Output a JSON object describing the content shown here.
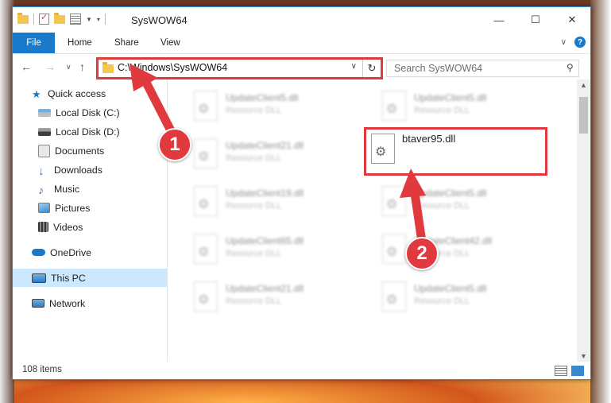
{
  "window": {
    "title": "SysWOW64"
  },
  "ribbon": {
    "tabs": [
      "File",
      "Home",
      "Share",
      "View"
    ]
  },
  "address": {
    "path": "C:\\Windows\\SysWOW64"
  },
  "search": {
    "placeholder": "Search SysWOW64"
  },
  "nav": {
    "items": [
      {
        "label": "Quick access",
        "icon": "star-icon",
        "pinned": false
      },
      {
        "label": "Local Disk (C:)",
        "icon": "drive-icon",
        "pinned": false
      },
      {
        "label": "Local Disk (D:)",
        "icon": "drive-icon",
        "pinned": false
      },
      {
        "label": "Documents",
        "icon": "documents-icon",
        "pinned": true
      },
      {
        "label": "Downloads",
        "icon": "download-icon",
        "pinned": true
      },
      {
        "label": "Music",
        "icon": "music-icon",
        "pinned": true
      },
      {
        "label": "Pictures",
        "icon": "pictures-icon",
        "pinned": true
      },
      {
        "label": "Videos",
        "icon": "videos-icon",
        "pinned": true
      },
      {
        "label": "OneDrive",
        "icon": "cloud-icon",
        "pinned": false
      },
      {
        "label": "This PC",
        "icon": "computer-icon",
        "pinned": false
      },
      {
        "label": "Network",
        "icon": "network-icon",
        "pinned": false
      }
    ]
  },
  "files": {
    "items": [
      {
        "name": "UpdateClient5.dll",
        "type": "Resource DLL"
      },
      {
        "name": "UpdateClient5.dll",
        "type": "Resource DLL"
      },
      {
        "name": "UpdateClient21.dll",
        "type": "Resource DLL"
      },
      {
        "name": "UpdateClient19.dll",
        "type": "Resource DLL"
      },
      {
        "name": "UpdateClient5.dll",
        "type": "Resource DLL"
      },
      {
        "name": "UpdateClient65.dll",
        "type": "Resource DLL"
      },
      {
        "name": "UpdateClient42.dll",
        "type": "Resource DLL"
      },
      {
        "name": "UpdateClient21.dll",
        "type": "Resource DLL"
      },
      {
        "name": "UpdateClient5.dll",
        "type": "Resource DLL"
      }
    ],
    "highlighted": {
      "name": "btaver95.dll"
    }
  },
  "status": {
    "item_count": "108 items"
  },
  "callouts": {
    "step1": "1",
    "step2": "2",
    "color": "#e0393e"
  }
}
